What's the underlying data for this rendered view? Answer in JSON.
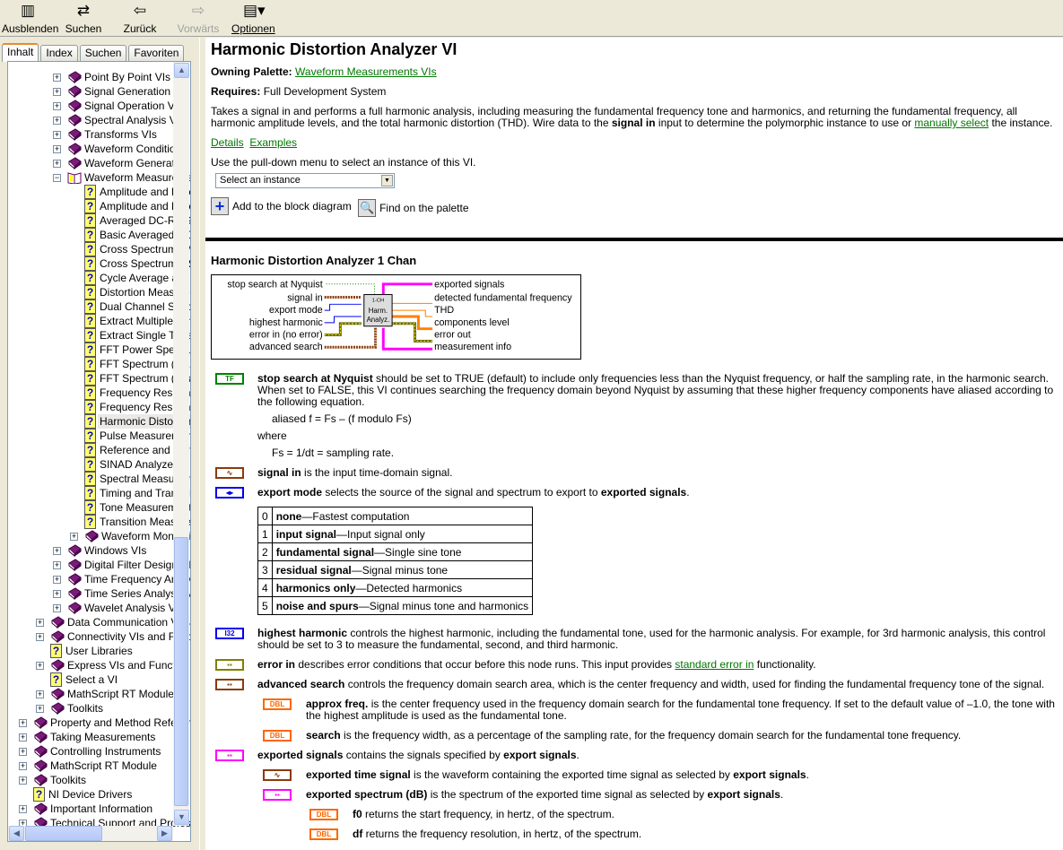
{
  "toolbar": {
    "hide": "Ausblenden",
    "search": "Suchen",
    "back": "Zurück",
    "forward": "Vorwärts",
    "options": "Optionen"
  },
  "tabs": [
    "Inhalt",
    "Index",
    "Suchen",
    "Favoriten"
  ],
  "tree": [
    {
      "l": 2,
      "t": "Point By Point VIs",
      "k": "book"
    },
    {
      "l": 2,
      "t": "Signal Generation VIs",
      "k": "book"
    },
    {
      "l": 2,
      "t": "Signal Operation VIs",
      "k": "book"
    },
    {
      "l": 2,
      "t": "Spectral Analysis VIs",
      "k": "book"
    },
    {
      "l": 2,
      "t": "Transforms VIs",
      "k": "book"
    },
    {
      "l": 2,
      "t": "Waveform Conditioning VIs",
      "k": "book"
    },
    {
      "l": 2,
      "t": "Waveform Generation VIs",
      "k": "book"
    },
    {
      "l": 2,
      "t": "Waveform Measurements VIs",
      "k": "open"
    },
    {
      "l": 3,
      "t": "Amplitude and Levels",
      "k": "doc"
    },
    {
      "l": 3,
      "t": "Amplitude and Levels",
      "k": "doc"
    },
    {
      "l": 3,
      "t": "Averaged DC-RMS",
      "k": "doc"
    },
    {
      "l": 3,
      "t": "Basic Averaged DC-RMS",
      "k": "doc"
    },
    {
      "l": 3,
      "t": "Cross Spectrum (Mag-Phase)",
      "k": "doc"
    },
    {
      "l": 3,
      "t": "Cross Spectrum (Real-Im)",
      "k": "doc"
    },
    {
      "l": 3,
      "t": "Cycle Average and RMS",
      "k": "doc"
    },
    {
      "l": 3,
      "t": "Distortion Measurements",
      "k": "doc"
    },
    {
      "l": 3,
      "t": "Dual Channel Spectral",
      "k": "doc"
    },
    {
      "l": 3,
      "t": "Extract Multiple Tone Info",
      "k": "doc"
    },
    {
      "l": 3,
      "t": "Extract Single Tone Info",
      "k": "doc"
    },
    {
      "l": 3,
      "t": "FFT Power Spectrum",
      "k": "doc"
    },
    {
      "l": 3,
      "t": "FFT Spectrum (Mag-Phase)",
      "k": "doc"
    },
    {
      "l": 3,
      "t": "FFT Spectrum (Real-Im)",
      "k": "doc"
    },
    {
      "l": 3,
      "t": "Frequency Response",
      "k": "doc"
    },
    {
      "l": 3,
      "t": "Frequency Response",
      "k": "doc"
    },
    {
      "l": 3,
      "t": "Harmonic Distortion Analyzer",
      "k": "doc",
      "sel": true
    },
    {
      "l": 3,
      "t": "Pulse Measurements",
      "k": "doc"
    },
    {
      "l": 3,
      "t": "Reference and Statistics",
      "k": "doc"
    },
    {
      "l": 3,
      "t": "SINAD Analyzer",
      "k": "doc"
    },
    {
      "l": 3,
      "t": "Spectral Measurements",
      "k": "doc"
    },
    {
      "l": 3,
      "t": "Timing and Transition",
      "k": "doc"
    },
    {
      "l": 3,
      "t": "Tone Measurements",
      "k": "doc"
    },
    {
      "l": 3,
      "t": "Transition Measurements",
      "k": "doc"
    },
    {
      "l": 3,
      "t": "Waveform Monitoring",
      "k": "book"
    },
    {
      "l": 2,
      "t": "Windows VIs",
      "k": "book"
    },
    {
      "l": 2,
      "t": "Digital Filter Design VIs",
      "k": "book"
    },
    {
      "l": 2,
      "t": "Time Frequency Analysis",
      "k": "book"
    },
    {
      "l": 2,
      "t": "Time Series Analysis VIs",
      "k": "book"
    },
    {
      "l": 2,
      "t": "Wavelet Analysis VIs",
      "k": "book"
    },
    {
      "l": 1,
      "t": "Data Communication VIs and Functions",
      "k": "book"
    },
    {
      "l": 1,
      "t": "Connectivity VIs and Functions",
      "k": "book"
    },
    {
      "l": 1,
      "t": "User Libraries",
      "k": "doc"
    },
    {
      "l": 1,
      "t": "Express VIs and Functions",
      "k": "book"
    },
    {
      "l": 1,
      "t": "Select a VI",
      "k": "doc"
    },
    {
      "l": 1,
      "t": "MathScript RT Module Functions",
      "k": "book"
    },
    {
      "l": 1,
      "t": "Toolkits",
      "k": "book"
    },
    {
      "l": 0,
      "t": "Property and Method Reference",
      "k": "book"
    },
    {
      "l": 0,
      "t": "Taking Measurements",
      "k": "book"
    },
    {
      "l": 0,
      "t": "Controlling Instruments",
      "k": "book"
    },
    {
      "l": 0,
      "t": "MathScript RT Module",
      "k": "book"
    },
    {
      "l": 0,
      "t": "Toolkits",
      "k": "book"
    },
    {
      "l": 0,
      "t": "NI Device Drivers",
      "k": "doc"
    },
    {
      "l": 0,
      "t": "Important Information",
      "k": "book"
    },
    {
      "l": 0,
      "t": "Technical Support and Professional Services",
      "k": "book"
    }
  ],
  "page": {
    "title": "Harmonic Distortion Analyzer VI",
    "owning_label": "Owning Palette:",
    "owning_link": "Waveform Measurements VIs",
    "requires_label": "Requires:",
    "requires": "Full Development System",
    "desc1": "Takes a signal in and performs a full harmonic analysis, including measuring the fundamental frequency tone and harmonics, and returning the fundamental frequency, all harmonic amplitude levels, and the total harmonic distortion (THD). Wire data to the ",
    "desc_bold": "signal in",
    "desc2": " input to determine the polymorphic instance to use or ",
    "desc_link": "manually select",
    "desc3": " the instance.",
    "details": "Details",
    "examples": "Examples",
    "pulldown_hint": "Use the pull-down menu to select an instance of this VI.",
    "select_value": "Select an instance",
    "add_label": "Add to the block diagram",
    "find_label": "Find on the palette"
  },
  "instance": {
    "title": "Harmonic Distortion Analyzer 1 Chan",
    "icon": [
      "1-CH",
      "Harm.",
      "Analyz."
    ],
    "inputs": [
      "stop search at Nyquist",
      "signal in",
      "export mode",
      "highest harmonic",
      "error in (no error)",
      "advanced search"
    ],
    "outputs": [
      "exported signals",
      "detected fundamental frequency",
      "THD",
      "components level",
      "error out",
      "measurement info"
    ]
  },
  "params": [
    {
      "lvl": 0,
      "badge": "TF",
      "color": "#008000",
      "segs": [
        [
          "stop search at Nyquist",
          1
        ],
        [
          " should be set to TRUE (default) to include only frequencies less than the Nyquist frequency, or half the sampling rate, in the harmonic search. When set to FALSE, this VI continues searching the frequency domain beyond Nyquist by assuming that these higher frequency components have aliased according to the following equation.",
          0
        ]
      ],
      "extra": [
        "aliased f = Fs – (f modulo Fs)",
        "where",
        "Fs = 1/dt = sampling rate."
      ]
    },
    {
      "lvl": 0,
      "badge": "∿",
      "color": "#8b3a0a",
      "segs": [
        [
          "signal in",
          1
        ],
        [
          " is the input time-domain signal.",
          0
        ]
      ]
    },
    {
      "lvl": 0,
      "badge": "◂▸",
      "color": "#0000ee",
      "segs": [
        [
          "export mode",
          1
        ],
        [
          " selects the source of the signal and spectrum to export to ",
          0
        ],
        [
          "exported signals",
          1
        ],
        [
          ".",
          0
        ]
      ],
      "table": [
        [
          "0",
          "none",
          "Fastest computation"
        ],
        [
          "1",
          "input signal",
          "Input signal only"
        ],
        [
          "2",
          "fundamental signal",
          "Single sine tone"
        ],
        [
          "3",
          "residual signal",
          "Signal minus tone"
        ],
        [
          "4",
          "harmonics only",
          "Detected harmonics"
        ],
        [
          "5",
          "noise and spurs",
          "Signal minus tone and harmonics"
        ]
      ]
    },
    {
      "lvl": 0,
      "badge": "I32",
      "color": "#0000ee",
      "segs": [
        [
          "highest harmonic",
          1
        ],
        [
          " controls the highest harmonic, including the fundamental tone, used for the harmonic analysis. For example, for 3rd harmonic analysis, this control should be set to 3 to measure the fundamental, second, and third harmonic.",
          0
        ]
      ]
    },
    {
      "lvl": 0,
      "badge": "▪▪",
      "color": "#808000",
      "segs": [
        [
          "error in",
          1
        ],
        [
          " describes error conditions that occur before this node runs. This input provides ",
          0
        ],
        [
          "standard error in",
          2
        ],
        [
          " functionality.",
          0
        ]
      ]
    },
    {
      "lvl": 0,
      "badge": "▪▪",
      "color": "#8b3a0a",
      "segs": [
        [
          "advanced search",
          1
        ],
        [
          " controls the frequency domain search area, which is the center frequency and width, used for finding the fundamental frequency tone of the signal.",
          0
        ]
      ]
    },
    {
      "lvl": 1,
      "badge": "DBL",
      "color": "#ff6600",
      "segs": [
        [
          "approx freq.",
          1
        ],
        [
          " is the center frequency used in the frequency domain search for the fundamental tone frequency. If set to the default value of –1.0, the tone with the highest amplitude is used as the fundamental tone.",
          0
        ]
      ]
    },
    {
      "lvl": 1,
      "badge": "DBL",
      "color": "#ff6600",
      "segs": [
        [
          "search",
          1
        ],
        [
          " is the frequency width, as a percentage of the sampling rate, for the frequency domain search for the fundamental tone frequency.",
          0
        ]
      ]
    },
    {
      "lvl": 0,
      "badge": "▪▪",
      "color": "#ff00ff",
      "segs": [
        [
          "exported signals",
          1
        ],
        [
          " contains the signals specified by ",
          0
        ],
        [
          "export signals",
          1
        ],
        [
          ".",
          0
        ]
      ]
    },
    {
      "lvl": 1,
      "badge": "∿",
      "color": "#8b3a0a",
      "segs": [
        [
          "exported time signal",
          1
        ],
        [
          " is the waveform containing the exported time signal as selected by ",
          0
        ],
        [
          "export signals",
          1
        ],
        [
          ".",
          0
        ]
      ]
    },
    {
      "lvl": 1,
      "badge": "▪▪",
      "color": "#ff00ff",
      "segs": [
        [
          "exported spectrum (dB)",
          1
        ],
        [
          " is the spectrum of the exported time signal as selected by ",
          0
        ],
        [
          "export signals",
          1
        ],
        [
          ".",
          0
        ]
      ]
    },
    {
      "lvl": 2,
      "badge": "DBL",
      "color": "#ff6600",
      "segs": [
        [
          "f0",
          1
        ],
        [
          " returns the start frequency, in hertz, of the spectrum.",
          0
        ]
      ]
    },
    {
      "lvl": 2,
      "badge": "DBL",
      "color": "#ff6600",
      "segs": [
        [
          "df",
          1
        ],
        [
          " returns the frequency resolution, in hertz, of the spectrum.",
          0
        ]
      ]
    }
  ]
}
